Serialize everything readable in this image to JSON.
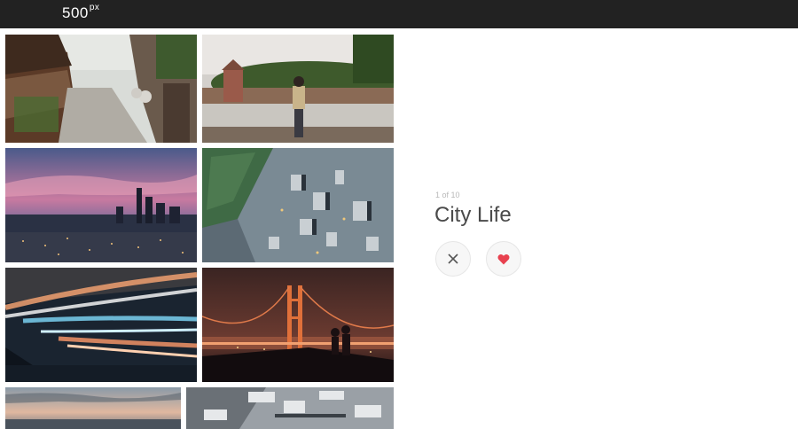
{
  "brand": {
    "logo_main": "500",
    "logo_sup": "px"
  },
  "gallery": {
    "photos": [
      {
        "name": "kyoto-street-photo"
      },
      {
        "name": "prague-viewpoint-photo"
      },
      {
        "name": "city-sunset-skyline-photo"
      },
      {
        "name": "aerial-city-photo"
      },
      {
        "name": "light-trails-photo"
      },
      {
        "name": "golden-gate-bridge-photo"
      },
      {
        "name": "coastal-sunset-photo"
      },
      {
        "name": "winter-aerial-photo"
      }
    ]
  },
  "panel": {
    "counter": "1 of 10",
    "title": "City Life",
    "dismiss_icon": "close-icon",
    "like_icon": "heart-icon"
  },
  "colors": {
    "topbar": "#222222",
    "heart": "#e8414f",
    "title": "#4a4a4a"
  }
}
